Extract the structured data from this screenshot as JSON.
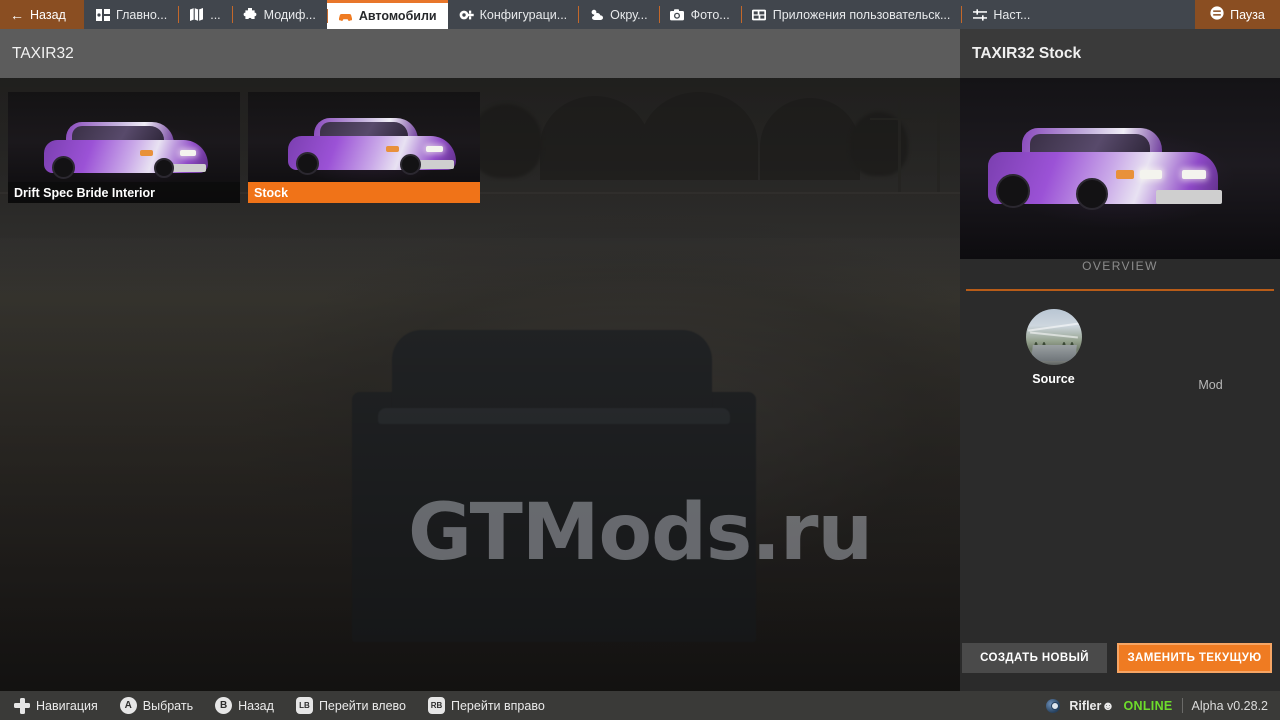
{
  "topbar": {
    "back_label": "Назад",
    "back_icon": "arrow-left-icon",
    "tabs": [
      {
        "label": "Главно...",
        "icon": "dashboard-icon",
        "active": false
      },
      {
        "label": "...",
        "icon": "map-icon",
        "active": false
      },
      {
        "label": "Модиф...",
        "icon": "puzzle-icon",
        "active": false
      },
      {
        "label": "Автомобили",
        "icon": "car-icon",
        "active": true
      },
      {
        "label": "Конфигураци...",
        "icon": "wrench-icon",
        "active": false
      },
      {
        "label": "Окру...",
        "icon": "weather-icon",
        "active": false
      },
      {
        "label": "Фото...",
        "icon": "camera-icon",
        "active": false
      },
      {
        "label": "Приложения пользовательск...",
        "icon": "apps-icon",
        "active": false
      },
      {
        "label": "Наст...",
        "icon": "sliders-icon",
        "active": false
      }
    ],
    "pause_label": "Пауза",
    "pause_icon": "menu-icon"
  },
  "left": {
    "header_title": "TAXIR32",
    "thumbnails": [
      {
        "label": "Drift Spec Bride Interior",
        "selected": false
      },
      {
        "label": "Stock",
        "selected": true
      }
    ]
  },
  "right": {
    "header_title": "TAXIR32 Stock",
    "preview_alt": "car-preview",
    "tab_label": "OVERVIEW",
    "source_label": "Source",
    "mod_label": "Mod",
    "create_new_label": "СОЗДАТЬ НОВЫЙ",
    "replace_current_label": "ЗАМЕНИТЬ ТЕКУЩУЮ"
  },
  "statusbar": {
    "hints": [
      {
        "button": "",
        "icon": "dpad-icon",
        "label": "Навигация"
      },
      {
        "button": "A",
        "icon": "a-button",
        "label": "Выбрать"
      },
      {
        "button": "B",
        "icon": "b-button",
        "label": "Назад"
      },
      {
        "button": "LB",
        "icon": "lb-button",
        "label": "Перейти влево"
      },
      {
        "button": "RB",
        "icon": "rb-button",
        "label": "Перейти вправо"
      }
    ],
    "steam_icon": "steam-icon",
    "username": "Rifler☻",
    "online_label": "ONLINE",
    "version": "Alpha v0.28.2"
  },
  "watermark": {
    "text": "GTMods.ru"
  },
  "colors": {
    "accent_orange": "#ef7b22",
    "tab_orange": "#e8762a",
    "selected_label": "#f07318",
    "online_green": "#6ddd2b",
    "topbar_bg": "#41464d",
    "left_header_bg": "#5c5c5c",
    "right_panel_bg": "#2b2b2b",
    "statusbar_bg": "#3a3a38"
  }
}
